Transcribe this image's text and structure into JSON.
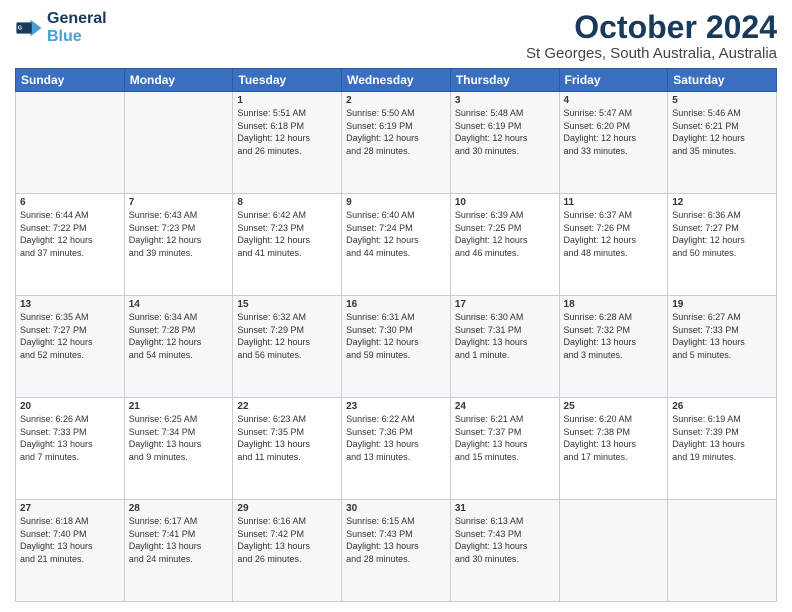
{
  "logo": {
    "line1": "General",
    "line2": "Blue"
  },
  "title": "October 2024",
  "subtitle": "St Georges, South Australia, Australia",
  "headers": [
    "Sunday",
    "Monday",
    "Tuesday",
    "Wednesday",
    "Thursday",
    "Friday",
    "Saturday"
  ],
  "weeks": [
    [
      {
        "day": "",
        "info": ""
      },
      {
        "day": "",
        "info": ""
      },
      {
        "day": "1",
        "info": "Sunrise: 5:51 AM\nSunset: 6:18 PM\nDaylight: 12 hours\nand 26 minutes."
      },
      {
        "day": "2",
        "info": "Sunrise: 5:50 AM\nSunset: 6:19 PM\nDaylight: 12 hours\nand 28 minutes."
      },
      {
        "day": "3",
        "info": "Sunrise: 5:48 AM\nSunset: 6:19 PM\nDaylight: 12 hours\nand 30 minutes."
      },
      {
        "day": "4",
        "info": "Sunrise: 5:47 AM\nSunset: 6:20 PM\nDaylight: 12 hours\nand 33 minutes."
      },
      {
        "day": "5",
        "info": "Sunrise: 5:46 AM\nSunset: 6:21 PM\nDaylight: 12 hours\nand 35 minutes."
      }
    ],
    [
      {
        "day": "6",
        "info": "Sunrise: 6:44 AM\nSunset: 7:22 PM\nDaylight: 12 hours\nand 37 minutes."
      },
      {
        "day": "7",
        "info": "Sunrise: 6:43 AM\nSunset: 7:23 PM\nDaylight: 12 hours\nand 39 minutes."
      },
      {
        "day": "8",
        "info": "Sunrise: 6:42 AM\nSunset: 7:23 PM\nDaylight: 12 hours\nand 41 minutes."
      },
      {
        "day": "9",
        "info": "Sunrise: 6:40 AM\nSunset: 7:24 PM\nDaylight: 12 hours\nand 44 minutes."
      },
      {
        "day": "10",
        "info": "Sunrise: 6:39 AM\nSunset: 7:25 PM\nDaylight: 12 hours\nand 46 minutes."
      },
      {
        "day": "11",
        "info": "Sunrise: 6:37 AM\nSunset: 7:26 PM\nDaylight: 12 hours\nand 48 minutes."
      },
      {
        "day": "12",
        "info": "Sunrise: 6:36 AM\nSunset: 7:27 PM\nDaylight: 12 hours\nand 50 minutes."
      }
    ],
    [
      {
        "day": "13",
        "info": "Sunrise: 6:35 AM\nSunset: 7:27 PM\nDaylight: 12 hours\nand 52 minutes."
      },
      {
        "day": "14",
        "info": "Sunrise: 6:34 AM\nSunset: 7:28 PM\nDaylight: 12 hours\nand 54 minutes."
      },
      {
        "day": "15",
        "info": "Sunrise: 6:32 AM\nSunset: 7:29 PM\nDaylight: 12 hours\nand 56 minutes."
      },
      {
        "day": "16",
        "info": "Sunrise: 6:31 AM\nSunset: 7:30 PM\nDaylight: 12 hours\nand 59 minutes."
      },
      {
        "day": "17",
        "info": "Sunrise: 6:30 AM\nSunset: 7:31 PM\nDaylight: 13 hours\nand 1 minute."
      },
      {
        "day": "18",
        "info": "Sunrise: 6:28 AM\nSunset: 7:32 PM\nDaylight: 13 hours\nand 3 minutes."
      },
      {
        "day": "19",
        "info": "Sunrise: 6:27 AM\nSunset: 7:33 PM\nDaylight: 13 hours\nand 5 minutes."
      }
    ],
    [
      {
        "day": "20",
        "info": "Sunrise: 6:26 AM\nSunset: 7:33 PM\nDaylight: 13 hours\nand 7 minutes."
      },
      {
        "day": "21",
        "info": "Sunrise: 6:25 AM\nSunset: 7:34 PM\nDaylight: 13 hours\nand 9 minutes."
      },
      {
        "day": "22",
        "info": "Sunrise: 6:23 AM\nSunset: 7:35 PM\nDaylight: 13 hours\nand 11 minutes."
      },
      {
        "day": "23",
        "info": "Sunrise: 6:22 AM\nSunset: 7:36 PM\nDaylight: 13 hours\nand 13 minutes."
      },
      {
        "day": "24",
        "info": "Sunrise: 6:21 AM\nSunset: 7:37 PM\nDaylight: 13 hours\nand 15 minutes."
      },
      {
        "day": "25",
        "info": "Sunrise: 6:20 AM\nSunset: 7:38 PM\nDaylight: 13 hours\nand 17 minutes."
      },
      {
        "day": "26",
        "info": "Sunrise: 6:19 AM\nSunset: 7:39 PM\nDaylight: 13 hours\nand 19 minutes."
      }
    ],
    [
      {
        "day": "27",
        "info": "Sunrise: 6:18 AM\nSunset: 7:40 PM\nDaylight: 13 hours\nand 21 minutes."
      },
      {
        "day": "28",
        "info": "Sunrise: 6:17 AM\nSunset: 7:41 PM\nDaylight: 13 hours\nand 24 minutes."
      },
      {
        "day": "29",
        "info": "Sunrise: 6:16 AM\nSunset: 7:42 PM\nDaylight: 13 hours\nand 26 minutes."
      },
      {
        "day": "30",
        "info": "Sunrise: 6:15 AM\nSunset: 7:43 PM\nDaylight: 13 hours\nand 28 minutes."
      },
      {
        "day": "31",
        "info": "Sunrise: 6:13 AM\nSunset: 7:43 PM\nDaylight: 13 hours\nand 30 minutes."
      },
      {
        "day": "",
        "info": ""
      },
      {
        "day": "",
        "info": ""
      }
    ]
  ]
}
